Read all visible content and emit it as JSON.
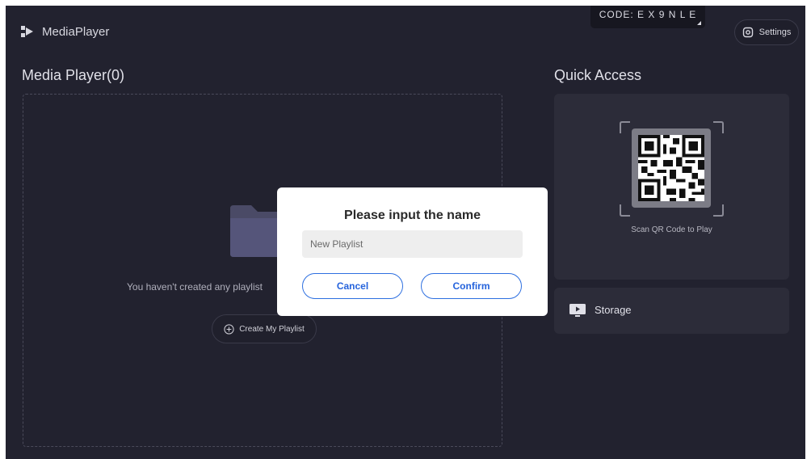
{
  "header": {
    "app_title": "MediaPlayer",
    "device_code": "CODE: E X 9 N L E",
    "settings_label": "Settings"
  },
  "main": {
    "section_title": "Media Player(0)",
    "empty_message": "You haven't created any playlist",
    "create_button_label": "Create My Playlist"
  },
  "quick_access": {
    "title": "Quick Access",
    "qr_caption": "Scan QR Code to Play",
    "storage_label": "Storage"
  },
  "dialog": {
    "title": "Please input the name",
    "input_placeholder": "New Playlist",
    "input_value": "",
    "cancel_label": "Cancel",
    "confirm_label": "Confirm"
  },
  "colors": {
    "background": "#22222f",
    "card": "#2c2c39",
    "accent": "#2563dc"
  },
  "icons": [
    "app-logo-icon",
    "settings-icon",
    "folder-icon",
    "plus-circle-icon",
    "qr-code-icon",
    "storage-monitor-icon"
  ]
}
